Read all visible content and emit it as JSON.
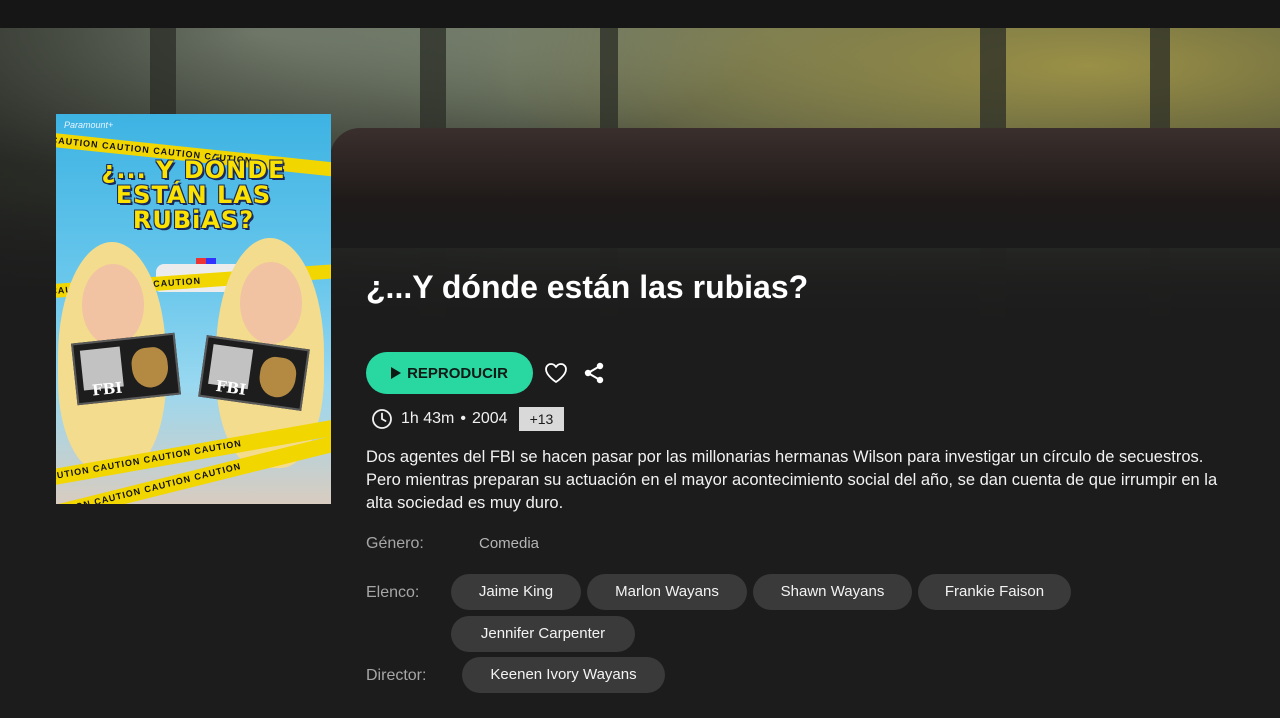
{
  "poster": {
    "brand": "Paramount+",
    "title_line1": "¿... Y DÓNDE",
    "title_line2": "ESTÁN LAS",
    "title_line3": "RUBiAS?",
    "tape_text": "CAUTION",
    "badge_text": "FBI"
  },
  "movie": {
    "title": "¿...Y dónde están las rubias?",
    "duration": "1h 43m",
    "separator": "•",
    "year": "2004",
    "rating": "+13",
    "synopsis": "Dos agentes del FBI se hacen pasar por las millonarias hermanas Wilson para investigar un círculo de secuestros. Pero mientras preparan su actuación en el mayor acontecimiento social del año, se dan cuenta de que irrumpir en la alta sociedad es muy duro."
  },
  "actions": {
    "play_label": "REPRODUCIR",
    "play_icon": "play-icon",
    "favorite_icon": "heart-icon",
    "share_icon": "share-icon"
  },
  "details": {
    "genre_label": "Género:",
    "genre": "Comedia",
    "cast_label": "Elenco:",
    "cast": [
      "Jaime King",
      "Marlon Wayans",
      "Shawn Wayans",
      "Frankie Faison",
      "Jennifer Carpenter"
    ],
    "director_label": "Director:",
    "director": "Keenen Ivory Wayans"
  },
  "colors": {
    "accent": "#29d7a0",
    "background": "#1c1c1c",
    "chip": "#3a3a3a",
    "label": "#a6a6a6"
  }
}
